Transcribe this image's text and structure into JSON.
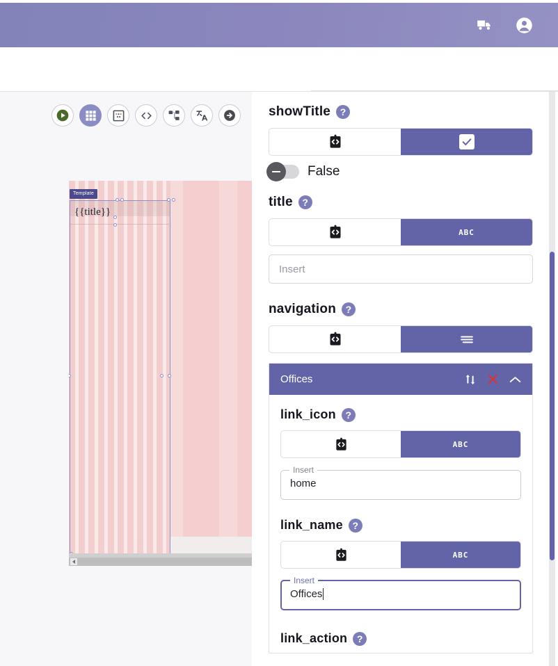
{
  "topbar": {
    "icons": [
      {
        "name": "delivery-truck-icon",
        "label": "Deliveries"
      },
      {
        "name": "account-circle-icon",
        "label": "Account"
      }
    ],
    "background_color": "#8a86bd"
  },
  "toolbar": {
    "buttons": [
      {
        "name": "run-preview-button",
        "icon": "play-icon",
        "active": false
      },
      {
        "name": "grid-view-button",
        "icon": "grid-icon",
        "active": true
      },
      {
        "name": "layout-regions-button",
        "icon": "layout-dots-icon",
        "active": false
      },
      {
        "name": "source-code-button",
        "icon": "code-brackets-icon",
        "active": false
      },
      {
        "name": "structure-tree-button",
        "icon": "sitemap-icon",
        "active": false
      },
      {
        "name": "translate-button",
        "icon": "translate-icon",
        "active": false
      },
      {
        "name": "next-step-button",
        "icon": "arrow-right-circle-icon",
        "active": false
      }
    ]
  },
  "canvas": {
    "badge": "Template",
    "title_token": "{{title}}",
    "scroll_left_arrow": "◀"
  },
  "properties": [
    {
      "key": "showTitle",
      "label": "showTitle",
      "help": "?",
      "mode_left_icon": "clipboard-code-icon",
      "mode_right_icon": "checkbox-icon",
      "mode_right_label": "",
      "active_mode": "value",
      "toggle": {
        "state": "off",
        "label": "False"
      }
    },
    {
      "key": "title",
      "label": "title",
      "help": "?",
      "mode_left_icon": "clipboard-code-icon",
      "mode_right_label": "ABC",
      "active_mode": "value",
      "input": {
        "value": "",
        "placeholder": "Insert"
      }
    },
    {
      "key": "navigation",
      "label": "navigation",
      "help": "?",
      "mode_left_icon": "clipboard-code-icon",
      "mode_right_icon": "list-lines-icon",
      "mode_right_label": "",
      "active_mode": "value"
    }
  ],
  "accordion": {
    "title": "Offices",
    "actions": [
      {
        "name": "sort-handle-icon",
        "glyph": "sort"
      },
      {
        "name": "delete-icon",
        "glyph": "x",
        "color": "#e03131"
      },
      {
        "name": "chevron-up-icon",
        "glyph": "chevron-up"
      }
    ],
    "fields": [
      {
        "key": "link_icon",
        "label": "link_icon",
        "help": "?",
        "mode_left_icon": "clipboard-code-icon",
        "mode_right_label": "ABC",
        "active_mode": "value",
        "input": {
          "legend": "Insert",
          "value": "home",
          "focused": false
        }
      },
      {
        "key": "link_name",
        "label": "link_name",
        "help": "?",
        "mode_left_icon": "clipboard-code-icon",
        "mode_right_label": "ABC",
        "active_mode": "value",
        "input": {
          "legend": "Insert",
          "value": "Offices",
          "focused": true
        }
      },
      {
        "key": "link_action",
        "label": "link_action",
        "help": "?"
      }
    ]
  },
  "colors": {
    "accent": "#6264a7",
    "header": "#8a86bd",
    "danger": "#e03131",
    "canvas_pink": "#f3cdcd"
  }
}
